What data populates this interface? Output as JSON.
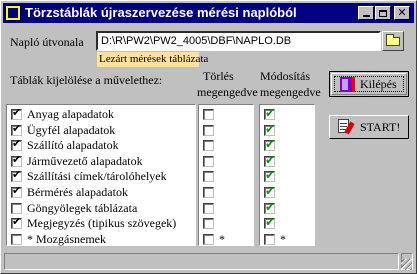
{
  "window": {
    "title": "Törzstáblák újraszervezése mérési naplóból",
    "controls": [
      "minimize",
      "maximize",
      "close"
    ],
    "close_glyph": "✕"
  },
  "log_path": {
    "label": "Napló útvonala",
    "value": "D:\\R\\PW2\\PW2_4005\\DBF\\NAPLO.DB"
  },
  "tooltip": "Lezárt mérések táblázata",
  "headers": {
    "tables_label": "Táblák kijelölése a művelethez:",
    "delete_col_line1": "Törlés",
    "delete_col_line2": "megengedve",
    "modify_col_line1": "Módosítás",
    "modify_col_line2": "megengedve"
  },
  "buttons": {
    "exit": "Kilépés",
    "start": "START!"
  },
  "tables": [
    {
      "name": "Anyag alapadatok",
      "selected": true,
      "delete_allowed": false,
      "modify_allowed": true,
      "delete_marker": "",
      "modify_marker": ""
    },
    {
      "name": "Ügyfél alapadatok",
      "selected": true,
      "delete_allowed": false,
      "modify_allowed": true,
      "delete_marker": "",
      "modify_marker": ""
    },
    {
      "name": "Szállító alapadatok",
      "selected": true,
      "delete_allowed": false,
      "modify_allowed": true,
      "delete_marker": "",
      "modify_marker": ""
    },
    {
      "name": "Járművezető alapadatok",
      "selected": true,
      "delete_allowed": false,
      "modify_allowed": true,
      "delete_marker": "",
      "modify_marker": ""
    },
    {
      "name": "Szállítási címek/tárolóhelyek",
      "selected": true,
      "delete_allowed": false,
      "modify_allowed": true,
      "delete_marker": "",
      "modify_marker": ""
    },
    {
      "name": "Bérmérés alapadatok",
      "selected": true,
      "delete_allowed": false,
      "modify_allowed": true,
      "delete_marker": "",
      "modify_marker": ""
    },
    {
      "name": "Göngyölegek táblázata",
      "selected": false,
      "delete_allowed": false,
      "modify_allowed": true,
      "delete_marker": "",
      "modify_marker": ""
    },
    {
      "name": "Megjegyzés (tipikus szövegek)",
      "selected": true,
      "delete_allowed": false,
      "modify_allowed": true,
      "delete_marker": "",
      "modify_marker": ""
    },
    {
      "name": "* Mozgásnemek",
      "selected": false,
      "delete_allowed": false,
      "modify_allowed": false,
      "delete_marker": "*",
      "modify_marker": "*"
    }
  ],
  "colors": {
    "titlebar": "#000080",
    "face": "#c0c0c0",
    "tooltip_bg": "#ffe0a0",
    "check_green": "#00a000"
  }
}
